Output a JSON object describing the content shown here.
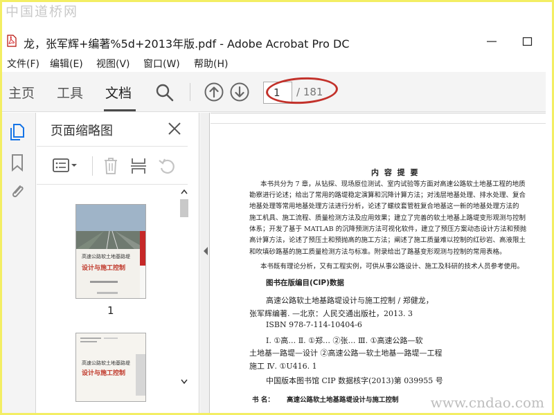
{
  "watermark": {
    "top": "中国道桥网",
    "bottom": "www.cndao.com"
  },
  "window": {
    "title": "龙，张军辉+编著%5d+2013年版.pdf - Adobe Acrobat Pro DC"
  },
  "menu": [
    "文件(F)",
    "编辑(E)",
    "视图(V)",
    "窗口(W)",
    "帮助(H)"
  ],
  "toolbar": {
    "tabs": [
      "主页",
      "工具",
      "文档"
    ],
    "active_tab": "文档",
    "page_current": "1",
    "page_total": "/ 181"
  },
  "sidebar": {
    "icons": [
      "pages-icon",
      "bookmark-icon",
      "attachment-icon"
    ]
  },
  "thumb_panel": {
    "title": "页面缩略图",
    "thumbnails": [
      {
        "label": "1",
        "cover_small": "高速公路软土地基路堤",
        "cover_red": "设计与施工控制"
      },
      {
        "label": "",
        "cover_small": "高速公路软土地基路堤",
        "cover_red": "设计与施工控制"
      }
    ]
  },
  "document": {
    "heading": "内 容 提 要",
    "paragraph1": [
      "本书共分为 7 章，从钻探、现场原位测试、室内试验等方面对高速公路软土地基工程的地质",
      "勘察进行论述；给出了常用的路堤稳定演算和沉降计算方法；对浅层地基处理、排水处理、复合",
      "地基处理等常用地基处理方法进行分析，论述了螺纹套管桩复合地基这一新的地基处理方法的",
      "施工机具、施工流程、质量检测方法及应用效果；建立了完善的软土地基上路堤变形观测与控制",
      "体系；开发了基于 MATLAB 的沉降预测方法可视化软件，建立了预压方案动态设计方法和预抛",
      "高计算方法，论述了预压土和预抛高的施工方法；阐述了施工质量难以控制的红砂岩、高液限土",
      "和吹填砂路基的施工质量检测方法与标准。附录给出了路基变形观测与控制的常用表格。"
    ],
    "paragraph2": "本书既有理论分析，又有工程实例，可供从事公路设计、施工及科研的技术人员参考使用。",
    "cip_heading": "图书在版编目(CIP)数据",
    "cip_lines": [
      "高速公路软土地基路堤设计与施工控制 / 郑健龙，",
      "张军辉编著. —北京：人民交通出版社，2013. 3",
      "ISBN 978-7-114-10404-6",
      "Ⅰ. ①高…  Ⅱ. ①郑…  ②张…   Ⅲ. ①高速公路—软",
      "土地基—路堤—设计  ②高速公路—软土地基—路堤—工程",
      "施工  Ⅳ. ①U416. 1",
      "中国版本图书馆 CIP 数据核字(2013)第 039955 号"
    ],
    "book_line_label": "书    名：",
    "book_line_value": "高速公路软土地基路堤设计与施工控制"
  },
  "colors": {
    "accent": "#1473e6",
    "annotation": "#c2312a",
    "frame": "#f3ee63"
  }
}
